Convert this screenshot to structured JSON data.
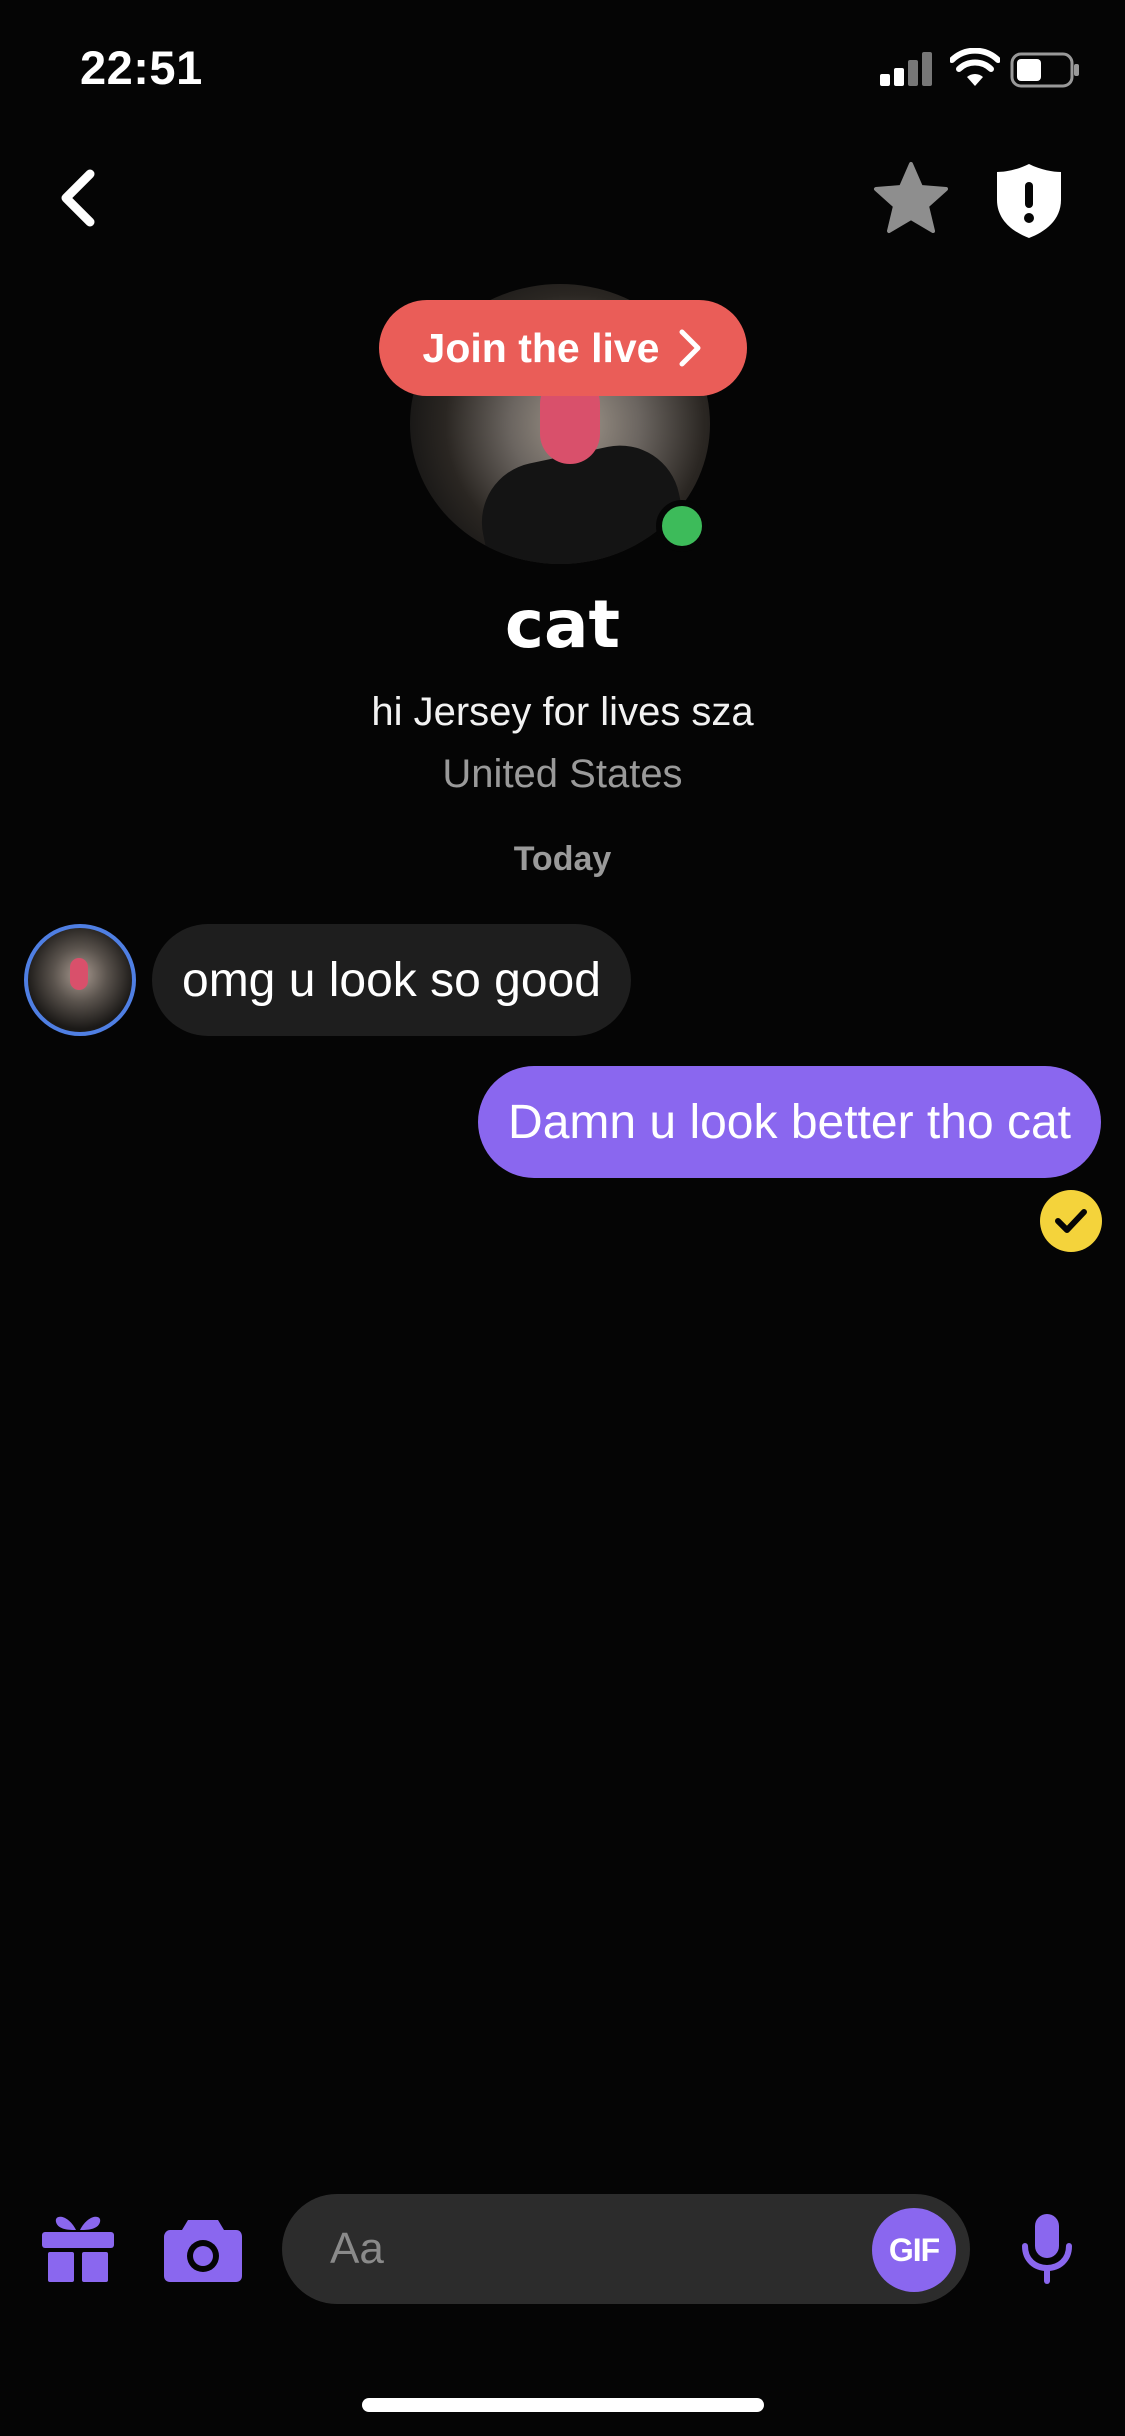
{
  "status_bar": {
    "time": "22:51"
  },
  "profile": {
    "live_button_label": "Join the live",
    "name": "cat",
    "bio": "hi Jersey for lives sza",
    "location": "United States"
  },
  "chat": {
    "date_separator": "Today",
    "messages": [
      {
        "direction": "incoming",
        "text": "omg u look so good"
      },
      {
        "direction": "outgoing",
        "text": "Damn u look better tho cat"
      }
    ]
  },
  "composer": {
    "placeholder": "Aa",
    "gif_label": "GIF"
  },
  "icons": [
    "back-icon",
    "star-icon",
    "shield-icon",
    "gift-icon",
    "camera-icon",
    "mic-icon"
  ],
  "colors": {
    "accent": "#8a67ef",
    "live": "#ea5d58",
    "online": "#3dbb5a",
    "read_receipt": "#f4d33b",
    "story_ring": "#4f7fe3"
  }
}
